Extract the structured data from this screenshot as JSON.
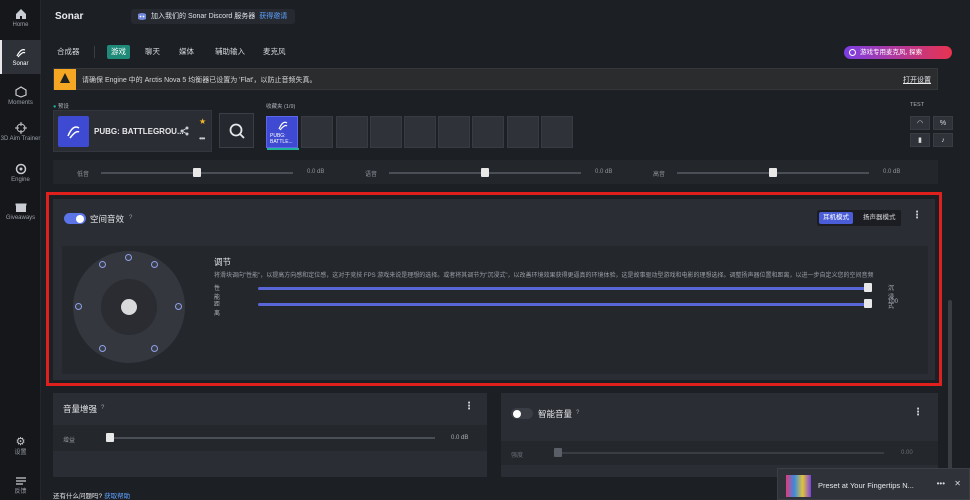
{
  "app": {
    "title": "Sonar"
  },
  "rail": [
    {
      "label": "Home",
      "icon": "home-icon"
    },
    {
      "label": "Sonar",
      "icon": "sonar-icon",
      "active": true
    },
    {
      "label": "Moments",
      "icon": "moments-icon"
    },
    {
      "label": "3D Aim Trainer",
      "icon": "aim-trainer-icon"
    },
    {
      "label": "Engine",
      "icon": "engine-icon"
    },
    {
      "label": "Giveaways",
      "icon": "giveaways-icon"
    },
    {
      "label": "设置",
      "icon": "gear-icon"
    },
    {
      "label": "反馈",
      "icon": "feedback-icon"
    }
  ],
  "header": {
    "discord_text": "加入我们的 Sonar Discord 服务器",
    "discord_link": "获得邀请"
  },
  "tabs": {
    "mixer": "合成器",
    "items": [
      "游戏",
      "聊天",
      "媒体",
      "辅助输入",
      "麦克风"
    ],
    "active_index": 0,
    "promo": "游戏专用麦克风, 探索"
  },
  "warning": {
    "text": "请确保 Engine 中的 Arctis Nova 5 均衡器已设置为 'Flat'，以防止音频失真。",
    "link": "打开设置"
  },
  "presets": {
    "preset_label": "预设",
    "favorites_label": "收藏夹 (1/9)",
    "test_label": "TEST",
    "current_name": "PUBG: BATTLEGROU...",
    "slot_name": "PUBG: BATTLE..."
  },
  "eq": [
    {
      "name": "低音",
      "value": "0.0 dB",
      "level": 0.5
    },
    {
      "name": "语音",
      "value": "0.0 dB",
      "level": 0.5
    },
    {
      "name": "高音",
      "value": "0.0 dB",
      "level": 0.5
    }
  ],
  "spatial": {
    "title": "空间音效",
    "help": "?",
    "mode_headphone": "耳机模式",
    "mode_speaker": "扬声器模式",
    "adjust_title": "调节",
    "adjust_desc": "将滑块调向\"性能\"，以提高方向感和定位感，这对于竞技 FPS 游戏来说是理想的选择。或者将其调节为\"沉浸式\"，以改善环境效果获得更逼真的环境体验，这是故事驱动型游戏和电影的理想选择。调整扬声器位置和距离，以进一步自定义您的空间音频",
    "sliders": [
      {
        "name": "性能",
        "value": "沉浸式",
        "level": 1.0
      },
      {
        "name": "距离",
        "value": "100",
        "level": 1.0
      }
    ]
  },
  "boost": {
    "title": "音量增强",
    "help": "?",
    "slider_name": "增益",
    "value": "0.0 dB",
    "level": 0.0
  },
  "smart": {
    "title": "智能音量",
    "help": "?",
    "slider_name": "强度",
    "value": "0.00",
    "level": 0.0
  },
  "footer": {
    "question": "还有什么问题吗?",
    "link": "获取帮助"
  },
  "toast": {
    "title": "Preset at Your Fingertips N..."
  },
  "colors": {
    "accent": "#5b74e8",
    "tab_active": "#1f8a78",
    "warning": "#f5a623",
    "highlight": "#e0201c"
  }
}
